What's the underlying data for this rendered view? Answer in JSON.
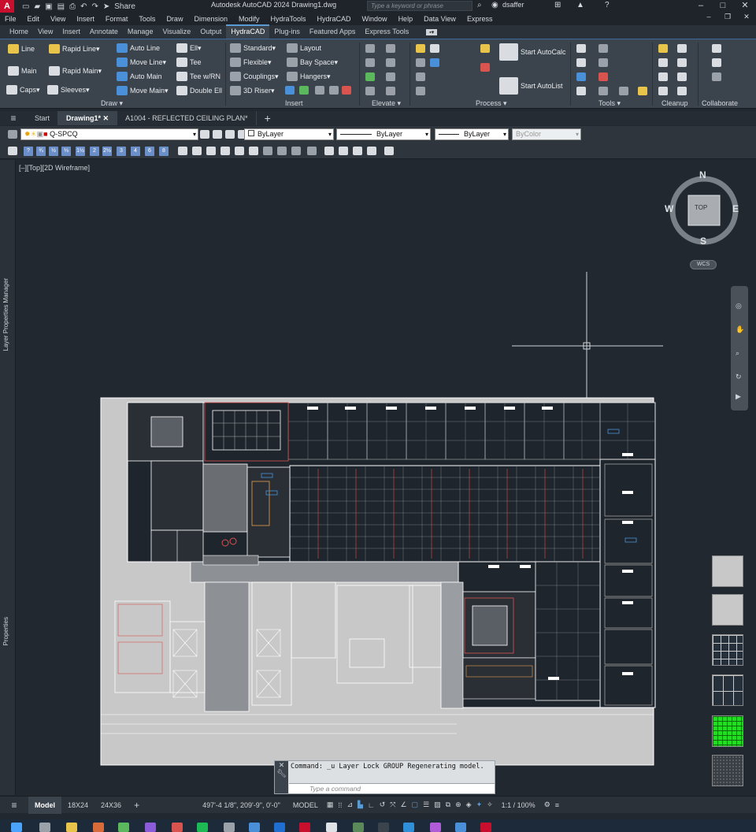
{
  "titlebar": {
    "app_icon": "A",
    "share_label": "Share",
    "title": "Autodesk AutoCAD 2024   Drawing1.dwg",
    "search_placeholder": "Type a keyword or phrase",
    "user": "dsaffer"
  },
  "menubar": [
    "File",
    "Edit",
    "View",
    "Insert",
    "Format",
    "Tools",
    "Draw",
    "Dimension",
    "Modify",
    "HydraTools",
    "HydraCAD",
    "Window",
    "Help",
    "Data View",
    "Express"
  ],
  "ribbon_tabs": [
    "Home",
    "View",
    "Insert",
    "Annotate",
    "Manage",
    "Visualize",
    "Output",
    "HydraCAD",
    "Plug-ins",
    "Featured Apps",
    "Express Tools"
  ],
  "active_ribbon_tab": "HydraCAD",
  "ribbon": {
    "draw": {
      "line": "Line",
      "rapid_line": "Rapid Line",
      "main": "Main",
      "rapid_main": "Rapid Main",
      "caps": "Caps",
      "sleeves": "Sleeves",
      "auto_line": "Auto Line",
      "move_line": "Move Line",
      "auto_main": "Auto Main",
      "move_main": "Move Main",
      "ell": "Ell",
      "tee": "Tee",
      "tee_wrn": "Tee w/RN",
      "double_ell": "Double Ell"
    },
    "insert": {
      "standard": "Standard",
      "flexible": "Flexible",
      "couplings": "Couplings",
      "riser": "3D Riser",
      "layout": "Layout",
      "bay_space": "Bay Space",
      "hangers": "Hangers"
    },
    "process": {
      "start_autocalc": "Start AutoCalc",
      "start_autolist": "Start AutoList"
    },
    "groups": {
      "draw": "Draw",
      "insert": "Insert",
      "elevate": "Elevate",
      "process": "Process",
      "tools": "Tools",
      "cleanup": "Cleanup",
      "collaborate": "Collaborate"
    }
  },
  "doc_tabs": [
    "Start",
    "Drawing1*",
    "A1004 - REFLECTED CEILING PLAN*"
  ],
  "active_doc_tab": "Drawing1*",
  "layer_toolbar": {
    "layer": "Q-SPCQ",
    "color": "ByLayer",
    "linetype": "ByLayer",
    "lineweight": "ByLayer",
    "plotstyle": "ByColor"
  },
  "layer_buttons": [
    "?",
    "¾",
    "½",
    "⅓",
    "1½",
    "2",
    "2½",
    "3",
    "4",
    "6",
    "8"
  ],
  "left_panel": {
    "top_label": "Layer Properties Manager",
    "bottom_label": "Properties"
  },
  "viewport": {
    "label": "[–][Top][2D Wireframe]",
    "compass": {
      "n": "N",
      "s": "S",
      "e": "E",
      "w": "W",
      "top": "TOP"
    },
    "wcs": "WCS"
  },
  "command": {
    "history": "Command: _u Layer Lock GROUP Regenerating model.",
    "placeholder": "Type a command"
  },
  "statusbar": {
    "model_tab": "Model",
    "layouts": [
      "18X24",
      "24X36"
    ],
    "coords": "497'-4 1/8\", 209'-9\", 0'-0\"",
    "model": "MODEL",
    "scale": "1:1 / 100%"
  },
  "colors": {
    "accent": "#5b9bd5",
    "background": "#212830",
    "ribbon": "#3b434c",
    "green_swatch": "#22dd22"
  }
}
